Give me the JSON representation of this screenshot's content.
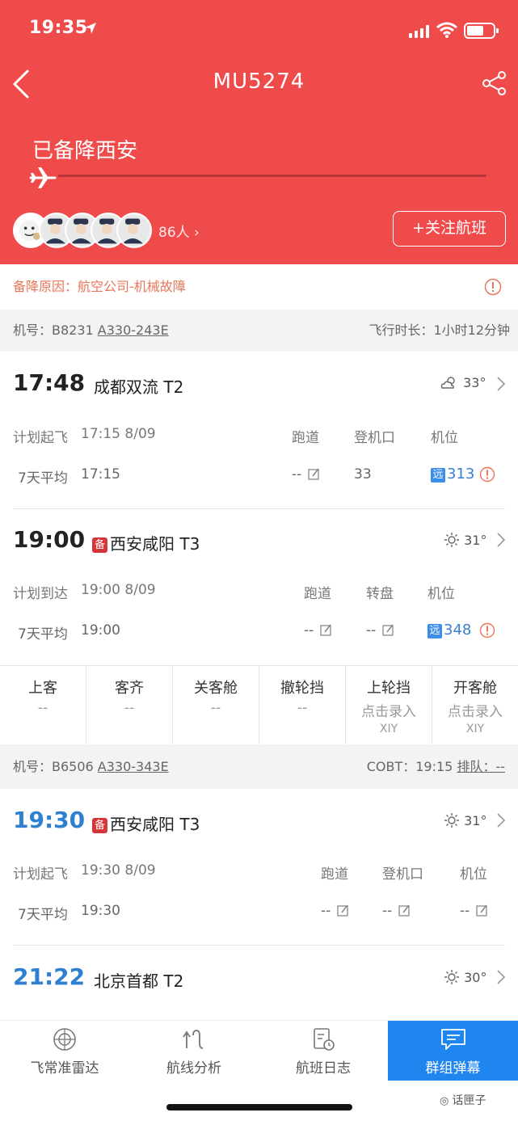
{
  "status_bar": {
    "time": "19:35"
  },
  "header": {
    "flight_no": "MU5274",
    "status": "已备降西安",
    "crew_count": "86人",
    "follow_label": "+关注航班"
  },
  "reason": "备降原因：航空公司-机械故障",
  "aircraft1": {
    "reg_label": "机号：B8231",
    "type": "A330-243E",
    "duration": "飞行时长：1小时12分钟"
  },
  "seg1": {
    "time": "17:48",
    "airport": "成都双流 T2",
    "weather": "33°",
    "plan_label": "计划起飞",
    "plan_value": "17:15 8/09",
    "col1": "跑道",
    "col2": "登机口",
    "col3": "机位",
    "avg_label": "7天平均",
    "avg_value": "17:15",
    "runway": "--",
    "gate": "33",
    "far": "远",
    "stand": "313"
  },
  "seg2": {
    "time": "19:00",
    "bei": "备",
    "airport": "西安咸阳 T3",
    "weather": "31°",
    "plan_label": "计划到达",
    "plan_value": "19:00 8/09",
    "col1": "跑道",
    "col2": "转盘",
    "col3": "机位",
    "avg_label": "7天平均",
    "avg_value": "19:00",
    "runway": "--",
    "carousel": "--",
    "far": "远",
    "stand": "348"
  },
  "ops": [
    {
      "title": "上客",
      "value": "--",
      "sub": ""
    },
    {
      "title": "客齐",
      "value": "--",
      "sub": ""
    },
    {
      "title": "关客舱",
      "value": "--",
      "sub": ""
    },
    {
      "title": "撤轮挡",
      "value": "--",
      "sub": ""
    },
    {
      "title": "上轮挡",
      "value": "点击录入",
      "sub": "XIY"
    },
    {
      "title": "开客舱",
      "value": "点击录入",
      "sub": "XIY"
    }
  ],
  "aircraft2": {
    "reg_label": "机号：B6506",
    "type": "A330-343E",
    "cobt": "COBT：19:15",
    "queue": "排队：--"
  },
  "seg3": {
    "time": "19:30",
    "bei": "备",
    "airport": "西安咸阳 T3",
    "weather": "31°",
    "plan_label": "计划起飞",
    "plan_value": "19:30 8/09",
    "col1": "跑道",
    "col2": "登机口",
    "col3": "机位",
    "avg_label": "7天平均",
    "avg_value": "19:30",
    "runway": "--",
    "gate": "--",
    "stand": "--"
  },
  "seg4": {
    "time": "21:22",
    "airport": "北京首都 T2",
    "weather": "30°"
  },
  "nav": [
    {
      "label": "飞常准雷达",
      "icon": "radar-icon"
    },
    {
      "label": "航线分析",
      "icon": "route-icon"
    },
    {
      "label": "航班日志",
      "icon": "log-icon"
    },
    {
      "label": "群组弹幕",
      "icon": "chat-icon"
    }
  ],
  "watermark": "话匣子",
  "colors": {
    "header": "#ef4b4b",
    "accent_blue": "#2f80d1",
    "nav_active": "#1f86f0",
    "reason": "#e8765a"
  }
}
